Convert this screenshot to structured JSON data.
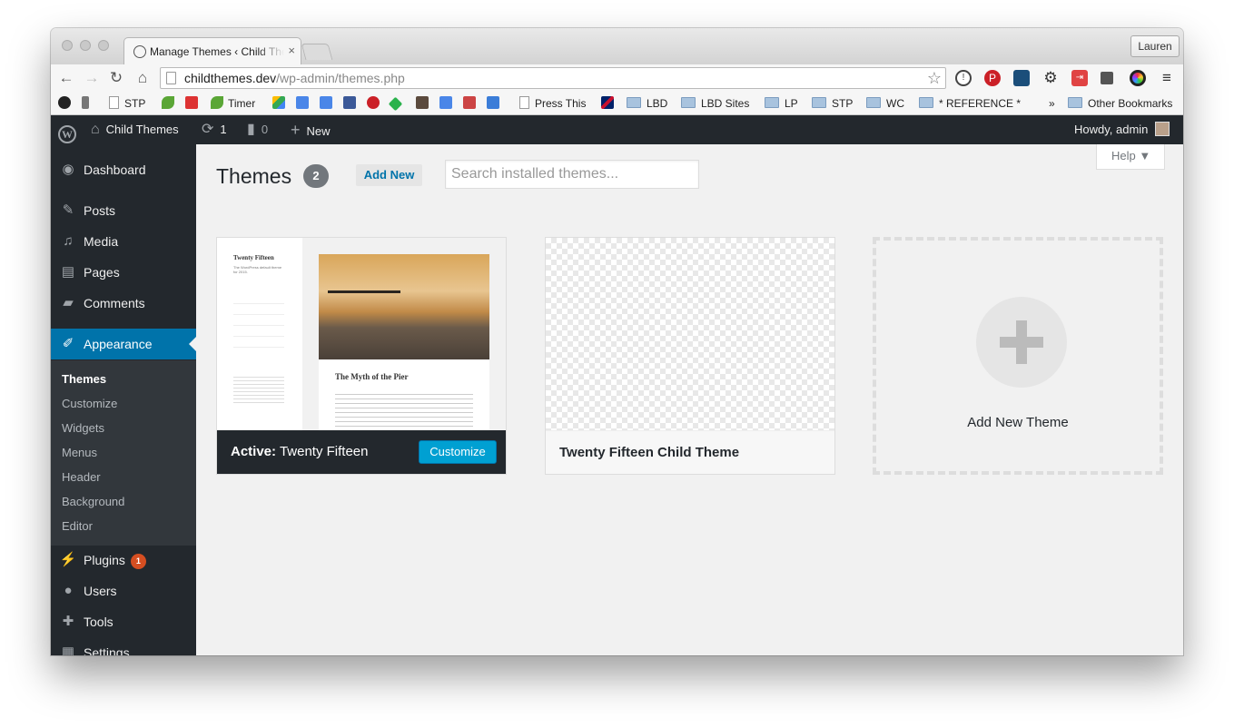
{
  "browser": {
    "tab_title": "Manage Themes ‹ Child Themes — WordPress",
    "tab_close": "×",
    "profile_name": "Lauren",
    "url_host": "childthemes.dev",
    "url_path": "/wp-admin/themes.php",
    "nav": {
      "back": "←",
      "forward": "→",
      "reload": "↻",
      "home": "⌂"
    },
    "star": "☆",
    "menu": "≡",
    "extension_icons": [
      "info-icon",
      "pinterest-icon",
      "screenshot-icon",
      "gear-icon",
      "exit-icon",
      "copy-icon",
      "color-wheel-icon"
    ]
  },
  "bookmarks": {
    "items": [
      {
        "label": "STP",
        "icon": "page-icon"
      },
      {
        "label": "Timer",
        "icon": "leaf-icon"
      },
      {
        "label": "Press This",
        "icon": "page-icon"
      },
      {
        "label": "LBD",
        "icon": "folder-icon"
      },
      {
        "label": "LBD Sites",
        "icon": "folder-icon"
      },
      {
        "label": "LP",
        "icon": "folder-icon"
      },
      {
        "label": "STP",
        "icon": "folder-icon"
      },
      {
        "label": "WC",
        "icon": "folder-icon"
      },
      {
        "label": "* REFERENCE *",
        "icon": "folder-icon"
      }
    ],
    "overflow": "»",
    "other": "Other Bookmarks"
  },
  "adminbar": {
    "site_name": "Child Themes",
    "updates_count": "1",
    "comments_count": "0",
    "new_label": "New",
    "howdy": "Howdy, admin"
  },
  "sidebar": {
    "items": [
      {
        "label": "Dashboard",
        "icon": "dashboard-icon"
      },
      {
        "label": "Posts",
        "icon": "pin-icon"
      },
      {
        "label": "Media",
        "icon": "media-icon"
      },
      {
        "label": "Pages",
        "icon": "pages-icon"
      },
      {
        "label": "Comments",
        "icon": "comment-icon"
      },
      {
        "label": "Appearance",
        "icon": "brush-icon"
      },
      {
        "label": "Plugins",
        "icon": "plug-icon",
        "badge": "1"
      },
      {
        "label": "Users",
        "icon": "user-icon"
      },
      {
        "label": "Tools",
        "icon": "wrench-icon"
      },
      {
        "label": "Settings",
        "icon": "settings-icon"
      }
    ],
    "submenu": [
      "Themes",
      "Customize",
      "Widgets",
      "Menus",
      "Header",
      "Background",
      "Editor"
    ]
  },
  "main": {
    "title": "Themes",
    "count": "2",
    "add_new": "Add New",
    "search_placeholder": "Search installed themes...",
    "help": "Help ▼",
    "themes": [
      {
        "name": "Twenty Fifteen",
        "active_prefix": "Active:",
        "button": "Customize"
      },
      {
        "name": "Twenty Fifteen Child Theme"
      }
    ],
    "add_new_theme": "Add New Theme",
    "preview": {
      "site_title": "Twenty Fifteen",
      "tagline": "The WordPress default theme for 2015.",
      "post_title": "The Myth of the Pier"
    }
  },
  "colors": {
    "accent": "#0073aa",
    "adminbar": "#23282d",
    "button": "#00a0d2",
    "badge": "#d54e21"
  }
}
